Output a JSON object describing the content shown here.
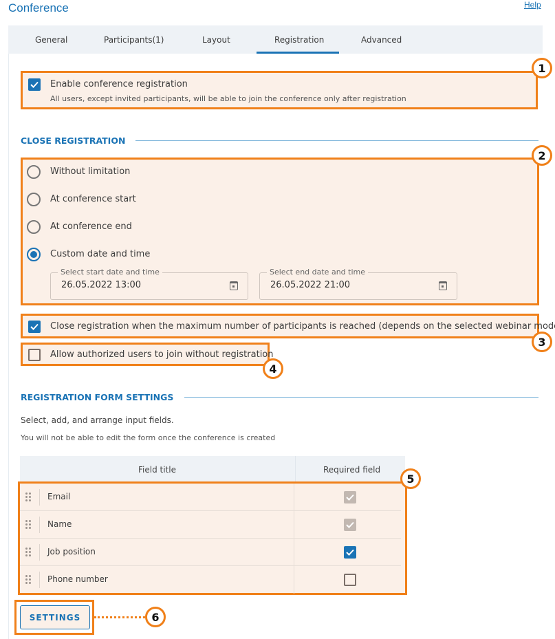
{
  "header": {
    "title": "Conference",
    "help_link": "Help"
  },
  "tabs": [
    {
      "label": "General",
      "active": false
    },
    {
      "label": "Participants(1)",
      "active": false
    },
    {
      "label": "Layout",
      "active": false
    },
    {
      "label": "Registration",
      "active": true
    },
    {
      "label": "Advanced",
      "active": false
    }
  ],
  "enable_registration": {
    "label": "Enable conference registration",
    "description": "All users, except invited participants, will be able to join the conference only after registration",
    "checked": true
  },
  "close_registration": {
    "section_title": "CLOSE REGISTRATION",
    "options": [
      {
        "label": "Without limitation",
        "selected": false
      },
      {
        "label": "At conference start",
        "selected": false
      },
      {
        "label": "At conference end",
        "selected": false
      },
      {
        "label": "Custom date and time",
        "selected": true
      }
    ],
    "start": {
      "label": "Select start date and time",
      "value": "26.05.2022 13:00"
    },
    "end": {
      "label": "Select end date and time",
      "value": "26.05.2022 21:00"
    },
    "max_participants": {
      "label": "Close registration when the maximum number of participants is reached (depends on the selected webinar mode)",
      "checked": true
    },
    "allow_authorized": {
      "label": "Allow authorized users to join without registration",
      "checked": false
    }
  },
  "form_settings": {
    "section_title": "REGISTRATION FORM SETTINGS",
    "hint": "Select, add, and arrange input fields.",
    "note": "You will not be able to edit the form once the conference is created",
    "columns": [
      "Field title",
      "Required field"
    ],
    "rows": [
      {
        "title": "Email",
        "required": "checked-disabled"
      },
      {
        "title": "Name",
        "required": "checked-disabled"
      },
      {
        "title": "Job position",
        "required": "checked"
      },
      {
        "title": "Phone number",
        "required": "unchecked"
      }
    ],
    "settings_button": "SETTINGS"
  },
  "annotations": [
    "1",
    "2",
    "3",
    "4",
    "5",
    "6"
  ],
  "colors": {
    "accent": "#1a73b5",
    "highlight_border": "#f08019",
    "highlight_fill": "#fbf0e8"
  }
}
